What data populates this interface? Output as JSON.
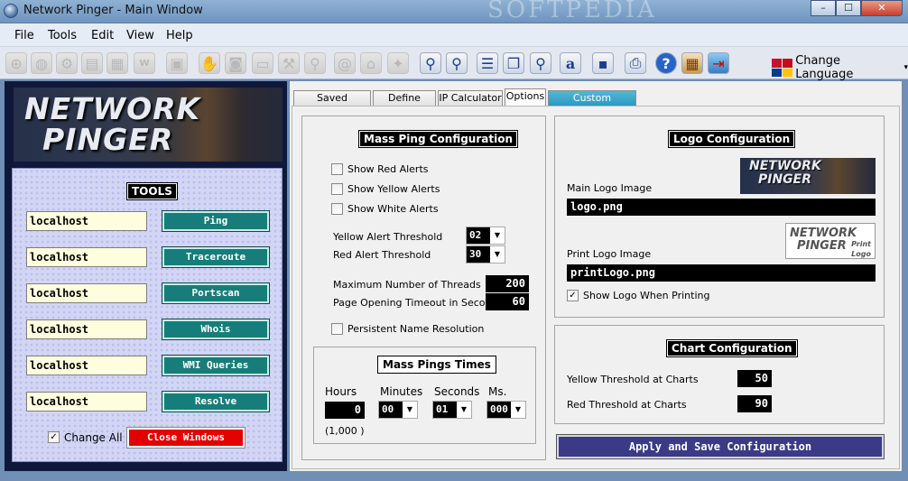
{
  "window": {
    "title": "Network Pinger - Main Window",
    "watermark": "SOFTPEDIA",
    "min": "–",
    "max": "☐",
    "close": "✕"
  },
  "menu": [
    "File",
    "Tools",
    "Edit",
    "View",
    "Help"
  ],
  "toolbar": {
    "language_label": "Change Language",
    "dropdown_arrow": "▾",
    "icons": [
      "crosshair-icon",
      "globe-icon",
      "network-icon",
      "server-icon",
      "grid-icon",
      "wmi-icon",
      "monitor-icon",
      "hand-icon",
      "camera-icon",
      "display-icon",
      "wrench-icon",
      "flashlight-icon",
      "at-icon",
      "bank-icon",
      "satellite-icon",
      "zoom-in-icon",
      "zoom-out-icon",
      "list-icon",
      "copy-icon",
      "search-icon",
      "font-icon",
      "save-icon",
      "print-icon",
      "help-icon",
      "calendar-icon",
      "exit-icon"
    ]
  },
  "left": {
    "logo_line1": "NETWORK",
    "logo_line2": "PINGER",
    "tools_title": "TOOLS",
    "rows": [
      {
        "host": "localhost",
        "button": "Ping"
      },
      {
        "host": "localhost",
        "button": "Traceroute"
      },
      {
        "host": "localhost",
        "button": "Portscan"
      },
      {
        "host": "localhost",
        "button": "Whois"
      },
      {
        "host": "localhost",
        "button": "WMI Queries"
      },
      {
        "host": "localhost",
        "button": "Resolve"
      }
    ],
    "change_all_label": "Change All",
    "change_all_checked": true,
    "close_windows": "Close Windows"
  },
  "tabs": [
    "Saved Sessions",
    "Define Hosts",
    "IP Calculator",
    "Options",
    "Custom Commands"
  ],
  "active_tab": "Options",
  "mass_ping": {
    "title": "Mass Ping Configuration",
    "show_red": "Show Red Alerts",
    "show_yellow": "Show Yellow Alerts",
    "show_white": "Show White Alerts",
    "yellow_thr_label": "Yellow Alert Threshold",
    "yellow_thr": "02",
    "red_thr_label": "Red Alert Threshold",
    "red_thr": "30",
    "max_threads_label": "Maximum Number of Threads",
    "max_threads": "200",
    "timeout_label": "Page Opening Timeout in Seconds",
    "timeout": "60",
    "persistent_label": "Persistent Name Resolution"
  },
  "ping_times": {
    "title": "Mass Pings Times",
    "hours_label": "Hours",
    "hours": "0",
    "minutes_label": "Minutes",
    "minutes": "00",
    "seconds_label": "Seconds",
    "seconds": "01",
    "ms_label": "Ms.",
    "ms": "000",
    "note": "(1,000 )"
  },
  "logo_cfg": {
    "title": "Logo Configuration",
    "main_label": "Main Logo Image",
    "main_file": "logo.png",
    "print_label": "Print Logo Image",
    "print_file": "printLogo.png",
    "show_label": "Show Logo When Printing",
    "show_checked": true,
    "preview_line1": "NETWORK",
    "preview_line2": "PINGER",
    "print_preview_line1": "NETWORK",
    "print_preview_line2": "PINGER",
    "print_preview_word1": "Print",
    "print_preview_word2": "Logo"
  },
  "chart_cfg": {
    "title": "Chart Configuration",
    "yellow_label": "Yellow Threshold at Charts",
    "yellow": "50",
    "red_label": "Red Threshold at Charts",
    "red": "90"
  },
  "apply": "Apply and Save Configuration"
}
